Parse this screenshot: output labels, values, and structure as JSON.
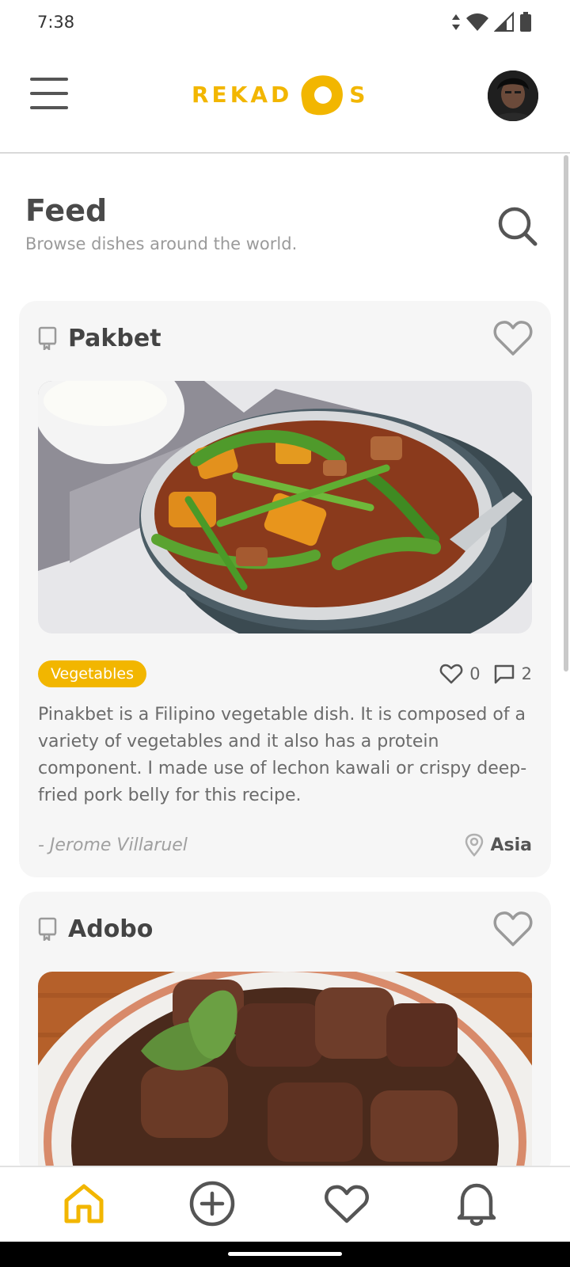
{
  "status_bar": {
    "time": "7:38",
    "icons": [
      "data-arrows-icon",
      "wifi-icon",
      "signal-icon",
      "battery-icon"
    ]
  },
  "header": {
    "logo_text_left": "REKAD",
    "logo_text_right": "S",
    "menu_icon": "hamburger-menu-icon",
    "avatar": "user-avatar"
  },
  "feed": {
    "title": "Feed",
    "subtitle": "Browse dishes around the world.",
    "search_icon": "search-icon"
  },
  "posts": [
    {
      "title": "Pakbet",
      "category": "Vegetables",
      "likes": "0",
      "comments": "2",
      "description": "Pinakbet is a Filipino vegetable dish. It is composed of a variety of vegetables and it also has a protein component. I made use of lechon kawali or crispy deep-fried pork belly for this recipe.",
      "author": "- Jerome Villaruel",
      "region": "Asia"
    },
    {
      "title": "Adobo"
    }
  ],
  "bottom_nav": {
    "items": [
      "home-icon",
      "add-circle-icon",
      "favorites-heart-icon",
      "notifications-bell-icon"
    ],
    "active": "home-icon"
  },
  "colors": {
    "accent": "#f2b600",
    "text_dark": "#4a4a4a",
    "text_muted": "#9a9a9a",
    "card_bg": "#f6f6f6"
  }
}
